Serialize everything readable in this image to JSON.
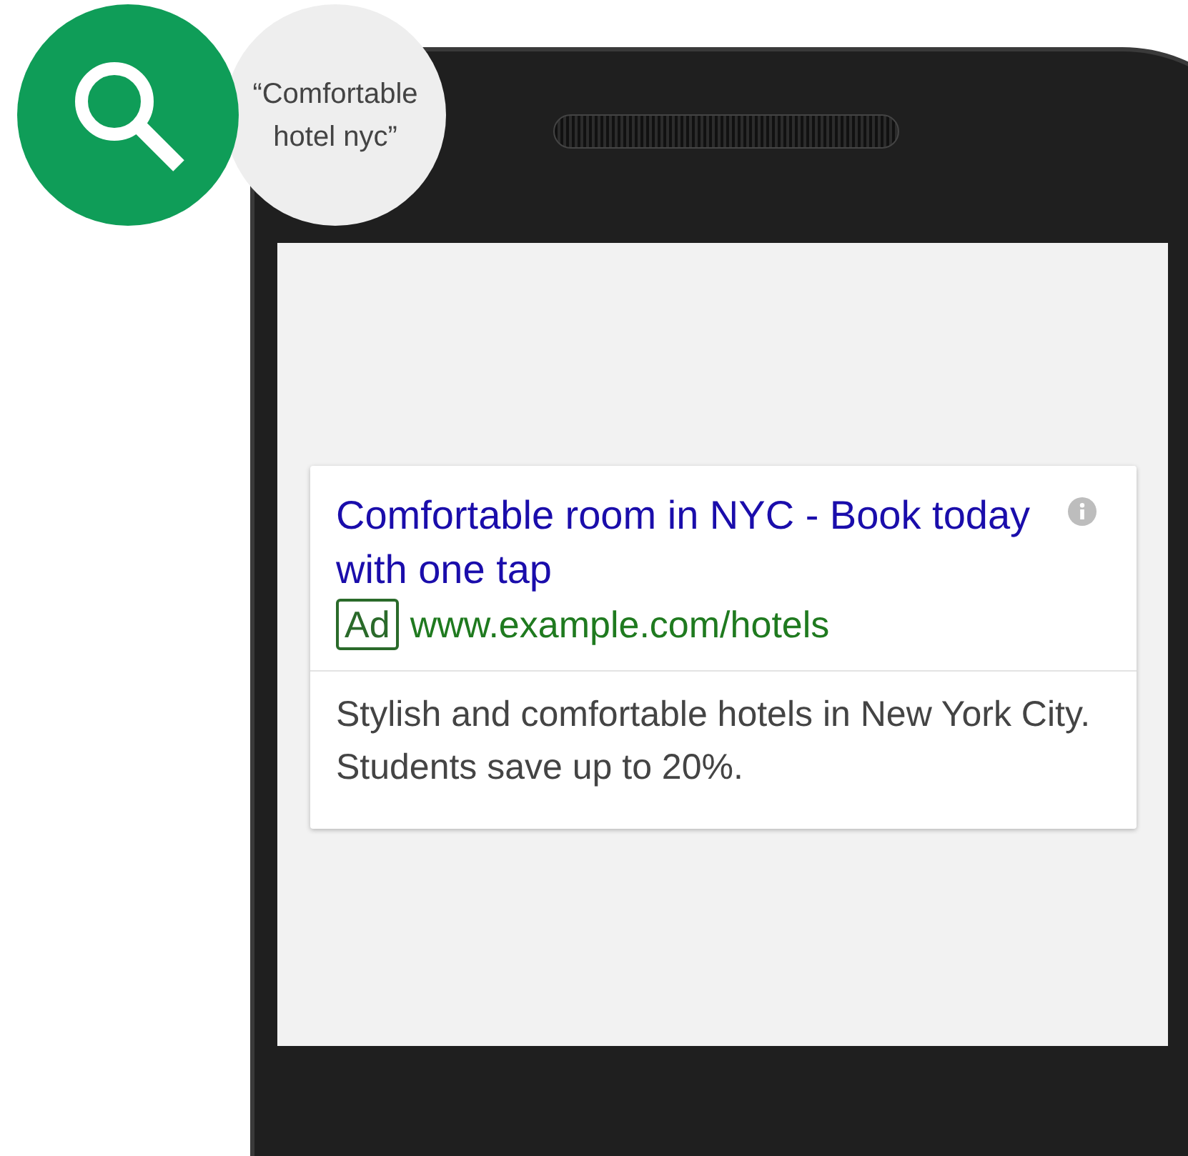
{
  "search_badge": {
    "query": "“Comfortable hotel nyc”"
  },
  "ad": {
    "title": "Comfortable room in NYC - Book today with one tap",
    "badge": "Ad",
    "url": "www.example.com/hotels",
    "description": "Stylish and comfortable hotels in New York City. Students save up to 20%."
  }
}
